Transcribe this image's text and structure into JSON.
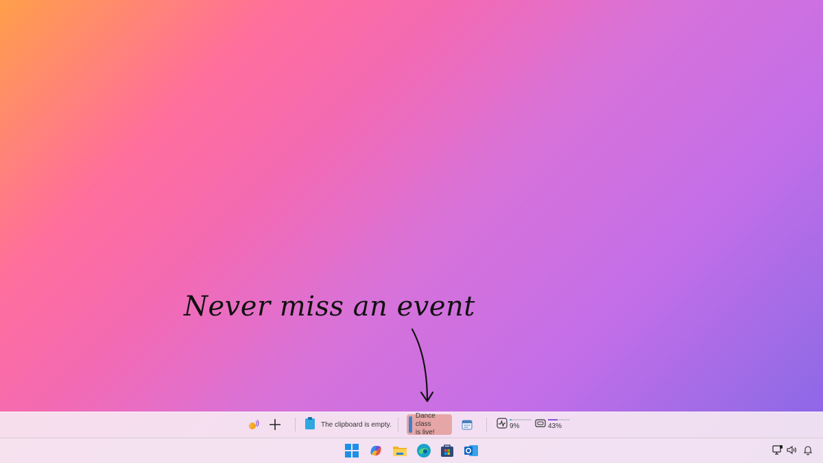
{
  "caption": "Never miss an event",
  "widget_bar": {
    "clipboard_text": "The clipboard is empty.",
    "event_line1": "Dance class",
    "event_line2": "is live!",
    "cpu_text": "9%",
    "cpu_value": 0.09,
    "gpu_text": "43%",
    "gpu_value": 0.43,
    "icons": [
      "wave-hand-icon",
      "plus-icon",
      "clipboard-icon",
      "calendar-icon",
      "activity-icon",
      "gpu-icon"
    ]
  },
  "taskbar": {
    "apps": [
      "windows-start-icon",
      "copilot-icon",
      "file-explorer-icon",
      "edge-icon",
      "store-icon",
      "outlook-icon"
    ],
    "tray": [
      "network-icon",
      "volume-icon",
      "notification-bell-icon"
    ]
  },
  "colors": {
    "event_card_bg": "#e6a6a6",
    "event_accent": "#3f7fcf",
    "gpu_fill": "#8a52d9"
  }
}
